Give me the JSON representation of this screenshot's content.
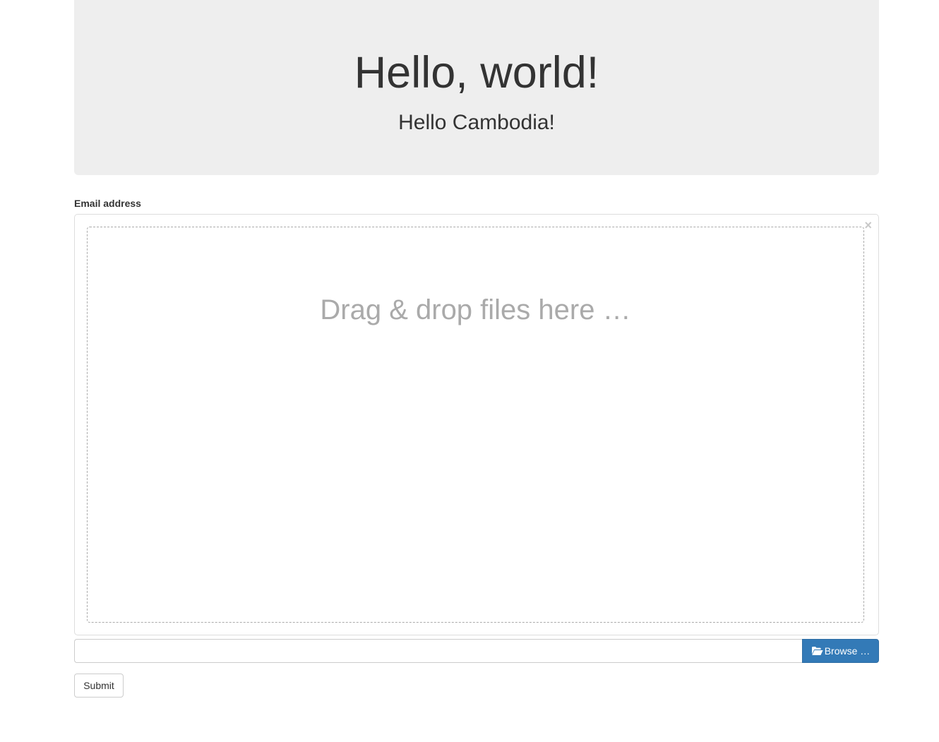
{
  "jumbotron": {
    "title": "Hello, world!",
    "subtitle": "Hello Cambodia!"
  },
  "form": {
    "label": "Email address",
    "close_symbol": "×",
    "drop_text": "Drag & drop files here …",
    "caption_value": "",
    "browse_label": "Browse …",
    "browse_icon": "folder-open-icon",
    "submit_label": "Submit"
  },
  "colors": {
    "jumbotron_bg": "#eeeeee",
    "primary": "#337ab7",
    "drop_text": "#aaaaaa"
  }
}
